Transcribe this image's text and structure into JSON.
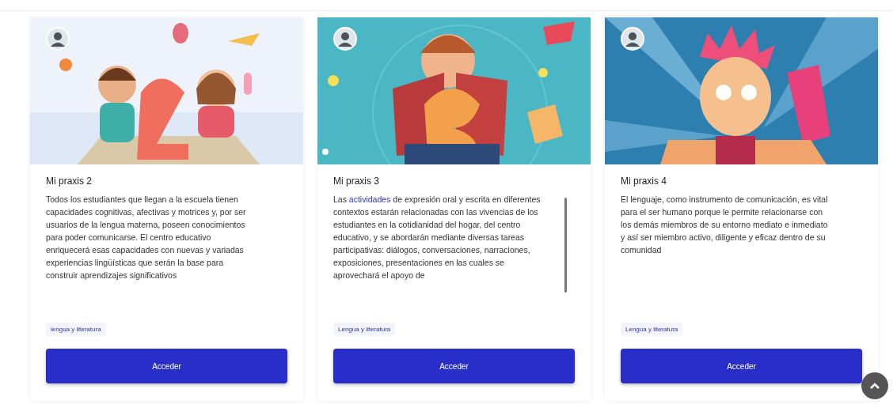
{
  "cards": [
    {
      "title": "Mi praxis 2",
      "description": [
        {
          "kind": "plain",
          "text": "Todos los estudiantes que llegan a la escuela tienen capacidades cognitivas, afectivas y motrices y, por ser usuarios de la lengua materna, poseen conocimientos para poder comunicarse. El centro educativo enriquecerá esas capacidades con nuevas y variadas experiencias lingüísticas que serán la base para construir aprendizajes significativos"
        }
      ],
      "scrollable": false,
      "tag": "lengua y literatura",
      "button": "Acceder"
    },
    {
      "title": "Mi praxis 3",
      "description": [
        {
          "kind": "plain",
          "text": "Las "
        },
        {
          "kind": "link",
          "text": "actividades"
        },
        {
          "kind": "plain",
          "text": " de expresión oral y escrita en diferentes contextos estarán relacionadas con las vivencias de los estudiantes en la cotidianidad del hogar, del centro educativo, y se abordarán mediante diversas tareas participativas: diálogos, conversaciones, narraciones, exposiciones, presentaciones en las cuales se aprovechará el apoyo de"
        }
      ],
      "scrollable": true,
      "tag": "Lengua y literatura",
      "button": "Acceder"
    },
    {
      "title": "Mi praxis 4",
      "description": [
        {
          "kind": "plain",
          "text": "El lenguaje, como instrumento de comunicación, es vital para el ser humano porque le permite relacionarse con los demás miembros de su entorno mediato e inmediato y así ser miembro activo, diligente y eficaz dentro de su comunidad"
        }
      ],
      "scrollable": false,
      "tag": "Lengua y literatura",
      "button": "Acceder"
    }
  ],
  "scroll_top_button": {
    "visible": true
  }
}
